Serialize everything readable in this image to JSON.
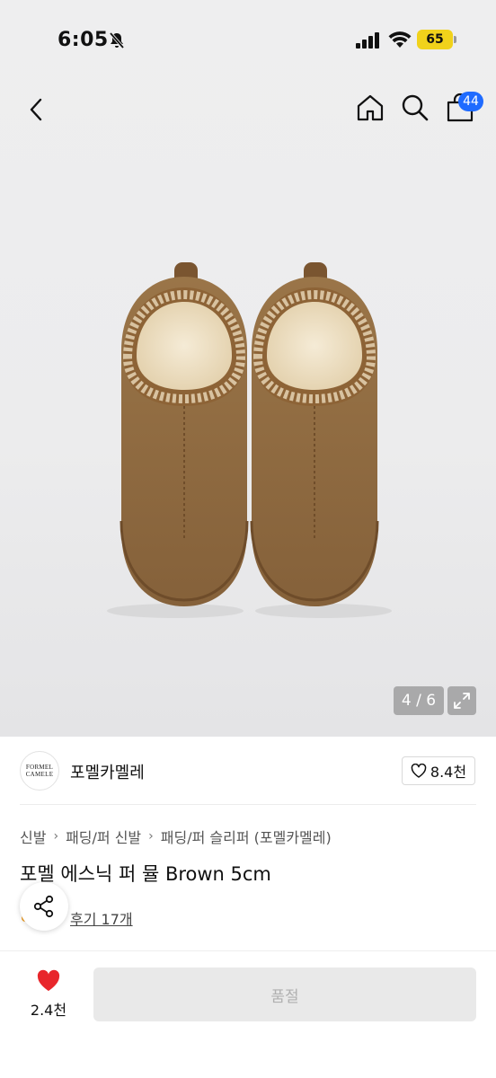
{
  "status": {
    "time": "6:05",
    "battery": "65"
  },
  "nav": {
    "cart_count": "44"
  },
  "gallery": {
    "counter": "4 / 6"
  },
  "brand": {
    "logo_line1": "FORMEL",
    "logo_line2": "CAMELE",
    "name": "포멜카멜레",
    "likes": "8.4천"
  },
  "breadcrumb": [
    "신발",
    "패딩/퍼 신발",
    "패딩/퍼 슬리퍼 (포멜카멜레)"
  ],
  "product": {
    "title": "포멜 에스닉 퍼 뮬 Brown 5cm",
    "reviews": "후기 17개"
  },
  "bottom": {
    "wish_count": "2.4천",
    "buy_label": "품절"
  },
  "colors": {
    "accent": "#1f6bff",
    "heart": "#e8262b",
    "disabled": "#e9e9e9",
    "battery": "#f1d21b"
  }
}
